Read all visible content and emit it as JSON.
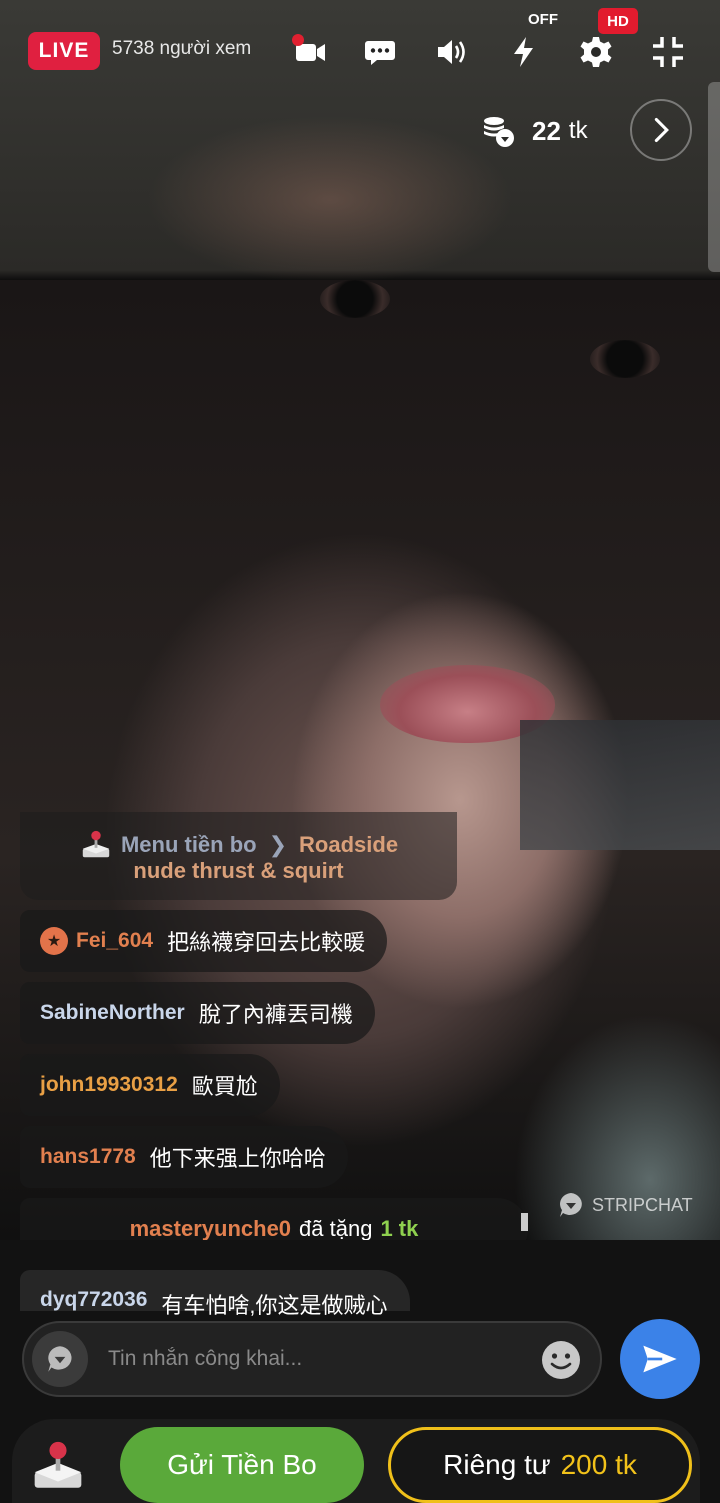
{
  "stream": {
    "live_label": "LIVE",
    "viewers": "5738 người xem",
    "flash_state": "OFF",
    "quality": "HD",
    "tokens_value": "22",
    "tokens_unit": "tk",
    "watermark": "STRIPCHAT"
  },
  "icons": [
    "camera-icon",
    "chat-icon",
    "volume-icon",
    "flash-icon",
    "settings-icon",
    "fullscreen-exit-icon",
    "tokens-icon",
    "chevron-right-icon",
    "joystick-icon",
    "emoji-icon",
    "send-icon"
  ],
  "tip_menu": {
    "label": "Menu tiền bo",
    "item": "Roadside",
    "item_line2": "nude thrust & squirt"
  },
  "messages": [
    {
      "user": "Fei_604",
      "text": "把絲襪穿回去比較暖",
      "user_color": "#e2804f",
      "badge": true
    },
    {
      "user": "SabineNorther",
      "text": "脫了內褲丟司機",
      "user_color": "#c9d6ea",
      "badge": false
    },
    {
      "user": "john19930312",
      "text": "歐買尬",
      "user_color": "#e9a045",
      "badge": false
    },
    {
      "user": "hans1778",
      "text": "他下来强上你哈哈",
      "user_color": "#e2804f",
      "badge": false
    },
    {
      "user": "dyq772036",
      "text": "有车怕啥,你这是做贼心",
      "user_color": "#c9d6ea",
      "badge": false
    }
  ],
  "gift": {
    "user": "masteryunche0",
    "verb": "đã tặng",
    "amount": "1 tk"
  },
  "composer": {
    "placeholder": "Tin nhắn công khai..."
  },
  "actions": {
    "tip_label": "Gửi Tiền Bo",
    "private_label": "Riêng tư",
    "private_price": "200 tk"
  },
  "colors": {
    "live_red": "#e02040",
    "tip_green": "#5aa93a",
    "private_gold": "#f0c01a",
    "send_blue": "#3b82e8"
  }
}
